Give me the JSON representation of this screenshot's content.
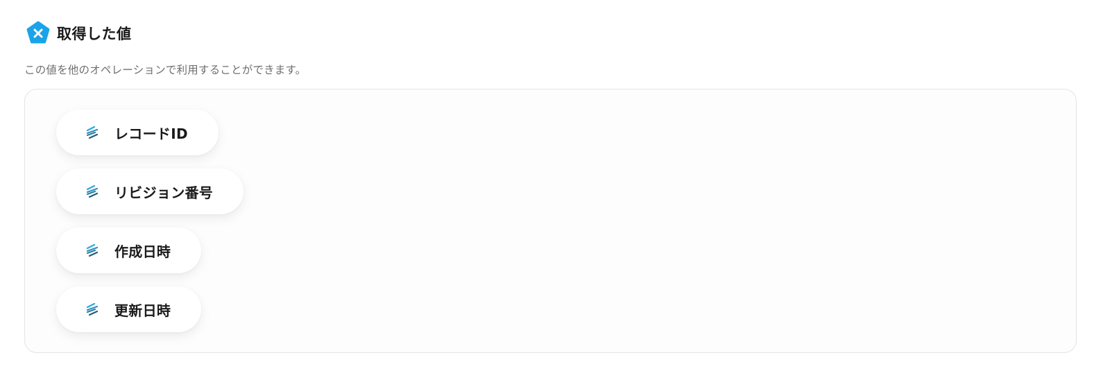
{
  "section": {
    "title": "取得した値",
    "icon": "variable-x-icon",
    "description": "この値を他のオペレーションで利用することができます。"
  },
  "values": [
    {
      "label": "レコードID",
      "icon": "kintone-lines-icon"
    },
    {
      "label": "リビジョン番号",
      "icon": "kintone-lines-icon"
    },
    {
      "label": "作成日時",
      "icon": "kintone-lines-icon"
    },
    {
      "label": "更新日時",
      "icon": "kintone-lines-icon"
    }
  ],
  "colors": {
    "accent": "#1aa3e8",
    "box_border": "#e4e4e6",
    "description_text": "#6f6f6f"
  }
}
